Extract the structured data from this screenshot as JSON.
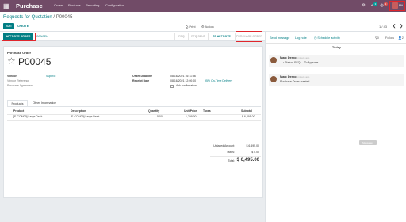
{
  "navbar": {
    "app_name": "Purchase",
    "menu": [
      "Orders",
      "Products",
      "Reporting",
      "Configuration"
    ],
    "chat_count": "3",
    "activity_count": "1",
    "user": "Mit"
  },
  "control_panel": {
    "breadcrumb_parent": "Requests for Quotation",
    "breadcrumb_sep": "/",
    "breadcrumb_current": "P00045",
    "edit_label": "EDIT",
    "create_label": "CREATE",
    "print_label": "Print",
    "action_label": "Action",
    "pager": "1 / 43"
  },
  "statusbar": {
    "approve_label": "APPROVE ORDER",
    "cancel_label": "CANCEL",
    "stages": [
      "RFQ",
      "RFQ SENT",
      "TO APPROVE",
      "PURCHASE ORDER"
    ],
    "active_stage": "TO APPROVE"
  },
  "sheet": {
    "title_label": "Purchase Order",
    "name": "P00045",
    "vendor_label": "Vendor",
    "vendor_value": "Supero",
    "vendor_ref_label": "Vendor Reference",
    "agreement_label": "Purchase Agreement",
    "deadline_label": "Order Deadline",
    "deadline_value": "08/16/2021 16:11:36",
    "receipt_label": "Receipt Date",
    "receipt_value": "08/16/2021 12:00:00",
    "receipt_status": "95% On-Time Delivery",
    "ask_confirmation": "Ask confirmation"
  },
  "tabs": [
    "Products",
    "Other Information"
  ],
  "table": {
    "headers": {
      "product": "Product",
      "description": "Description",
      "quantity": "Quantity",
      "unit_price": "Unit Price",
      "taxes": "Taxes",
      "subtotal": "Subtotal"
    },
    "rows": [
      {
        "product": "[E-COM09] Large Desk",
        "description": "[E-COM09] Large Desk",
        "quantity": "5.00",
        "unit_price": "1,299.00",
        "taxes": "",
        "subtotal": "$ 6,495.00"
      }
    ]
  },
  "totals": {
    "untaxed_label": "Untaxed Amount:",
    "untaxed_value": "$ 6,495.00",
    "taxes_label": "Taxes:",
    "taxes_value": "$ 0.00",
    "total_label": "Total:",
    "total_value": "$ 6,495.00"
  },
  "chatter": {
    "send_message": "Send message",
    "log_note": "Log note",
    "schedule_activity": "Schedule activity",
    "attachments": "0",
    "follow_label": "Follow",
    "followers": "2",
    "today_label": "Today",
    "messages": [
      {
        "author": "Marc Demo",
        "time": "1 minute ago",
        "body": "Status: RFQ → To Approve"
      },
      {
        "author": "Marc Demo",
        "time": "1 minute ago",
        "body": "Purchase Order created"
      }
    ],
    "bottom_button": "Messages"
  },
  "colors": {
    "brand": "#714b67",
    "accent": "#017e84",
    "highlight": "#e0262c"
  }
}
